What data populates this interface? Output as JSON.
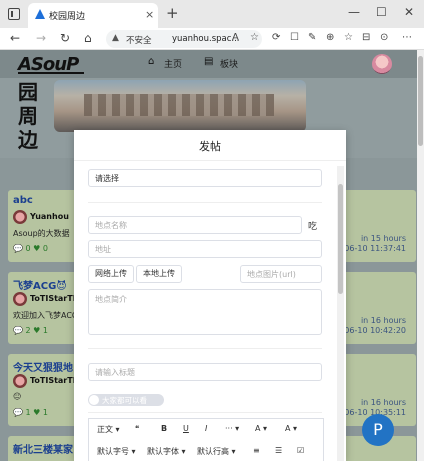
{
  "browser": {
    "tab_title": "校园周边",
    "tab_close": "×",
    "new_tab": "+",
    "minimize": "—",
    "maximize": "☐",
    "close": "✕",
    "back": "←",
    "forward": "→",
    "reload": "↻",
    "home": "⌂",
    "security_label": "不安全",
    "security_icon": "▲",
    "url": "yuanhou.spac...",
    "ext_icons": [
      "A",
      "☆",
      "⟳",
      "☐",
      "✎",
      "⊕",
      "☆",
      "⊟",
      "⊙",
      "⋯"
    ]
  },
  "site": {
    "logo": "ASouP",
    "nav": [
      {
        "icon": "home-icon",
        "glyph": "⌂",
        "label": "主页"
      },
      {
        "icon": "board-icon",
        "glyph": "▤",
        "label": "板块"
      }
    ],
    "banner_title": "园周边"
  },
  "posts": [
    {
      "title": "abc",
      "user": "Yuanhou",
      "text": "Asoup的大数据",
      "stats": "💬 0 ♥ 0",
      "time_ago": "in 15 hours",
      "time": "06-10 11:37:41"
    },
    {
      "title": "飞梦ACG😈",
      "user": "ToTIStarTM",
      "text": "欢迎加入飞梦ACG",
      "stats": "💬 2 ♥ 1",
      "time_ago": "in 16 hours",
      "time": "06-10 10:42:20"
    },
    {
      "title": "今天又狠狠地",
      "user": "ToTIStarTM",
      "text": "😐",
      "stats": "💬 1 ♥ 1",
      "time_ago": "in 16 hours",
      "time": "06-10 10:35:11"
    },
    {
      "title": "新北三楼某家",
      "user": "",
      "text": "",
      "stats": "",
      "time_ago": "",
      "time": ""
    }
  ],
  "modal": {
    "title": "发帖",
    "select_placeholder": "请选择",
    "place_name_placeholder": "地点名称",
    "eat_label": "吃",
    "address_placeholder": "地址",
    "web_upload": "网络上传",
    "local_upload": "本地上传",
    "place_image_placeholder": "地点图片(url)",
    "place_intro_placeholder": "地点简介",
    "tag_placeholder": "请输入标题",
    "visibility_label": "大家都可以看",
    "toolbar": {
      "row1": [
        "正文 ▾",
        "❝",
        "B",
        "U",
        "I",
        "··· ▾",
        "A ▾",
        "A ▾"
      ],
      "row2": [
        "默认字号 ▾",
        "默认字体 ▾",
        "默认行高 ▾",
        "≡",
        "☰",
        "☑"
      ]
    }
  },
  "fab_label": "P"
}
